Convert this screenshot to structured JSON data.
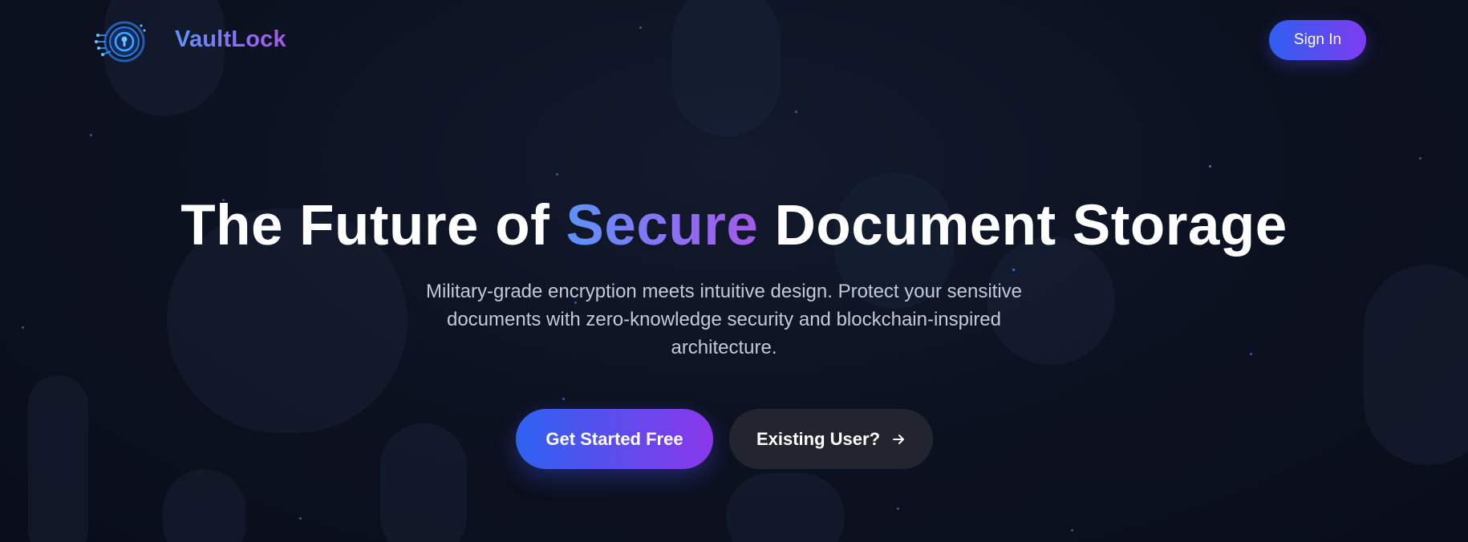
{
  "header": {
    "brand_name": "VaultLock",
    "logo_icon": "keyhole-shield-circuit-icon",
    "signin_label": "Sign In"
  },
  "hero": {
    "title_before": "The Future of ",
    "title_accent": "Secure",
    "title_after": " Document Storage",
    "subtitle": "Military-grade encryption meets intuitive design. Protect your sensitive documents with zero-knowledge security and blockchain-inspired architecture.",
    "primary_cta": "Get Started Free",
    "secondary_cta": "Existing User?",
    "secondary_cta_icon": "arrow-right-icon"
  },
  "colors": {
    "background": "#0d1220",
    "accent_blue": "#2f5ff0",
    "accent_purple": "#8a38ea",
    "secondary_button": "#22252f",
    "subtitle_text": "#c3c9d6"
  }
}
